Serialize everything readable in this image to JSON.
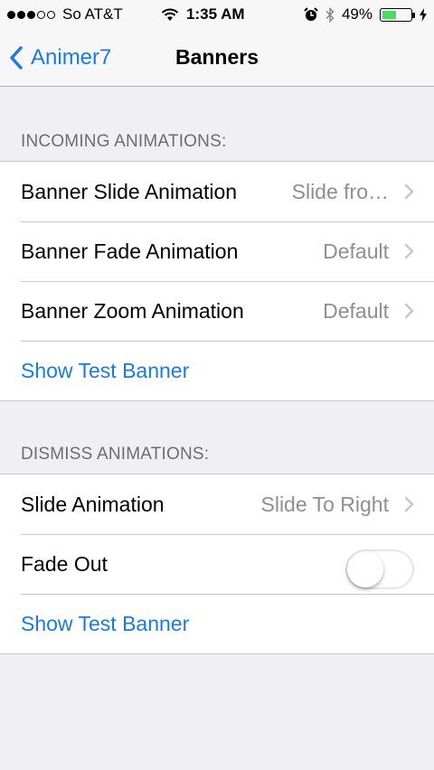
{
  "status_bar": {
    "carrier": "So AT&T",
    "time": "1:35 AM",
    "battery_percent": "49%",
    "battery_level": 0.49,
    "signal_bars_filled": 3,
    "signal_bars_total": 5,
    "icons": [
      "wifi-icon",
      "alarm-icon",
      "bluetooth-icon",
      "charging-icon"
    ]
  },
  "nav": {
    "back_label": "Animer7",
    "title": "Banners"
  },
  "incoming": {
    "header": "INCOMING ANIMATIONS:",
    "rows": [
      {
        "label": "Banner Slide Animation",
        "value": "Slide fro…"
      },
      {
        "label": "Banner Fade Animation",
        "value": "Default"
      },
      {
        "label": "Banner Zoom Animation",
        "value": "Default"
      }
    ],
    "test_label": "Show Test Banner"
  },
  "dismiss": {
    "header": "DISMISS ANIMATIONS:",
    "slide": {
      "label": "Slide Animation",
      "value": "Slide To Right"
    },
    "fade": {
      "label": "Fade Out",
      "on": false
    },
    "test_label": "Show Test Banner"
  },
  "colors": {
    "accent": "#1a7ae8",
    "background": "#efeff4",
    "battery": "#4cd964"
  }
}
